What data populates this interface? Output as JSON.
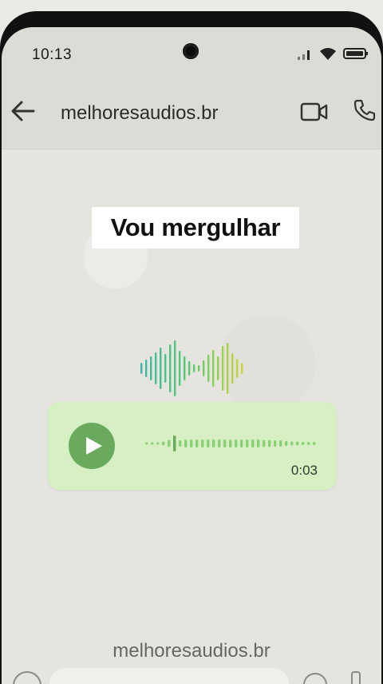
{
  "status_bar": {
    "time": "10:13"
  },
  "header": {
    "contact_name": "melhoresaudios.br",
    "icons": [
      "back-arrow-icon",
      "video-call-icon",
      "phone-call-icon"
    ]
  },
  "chat": {
    "caption": "Vou mergulhar",
    "voice_message": {
      "duration": "0:03",
      "progress": 0.0
    },
    "watermark": "melhoresaudios.br"
  },
  "colors": {
    "bubble": "#d6f0c4",
    "play_button": "#6aaa5e",
    "waveform_dots": "#8ccf76",
    "logo_gradient": [
      "#3cb8a6",
      "#5cc86a",
      "#c6d63a"
    ]
  }
}
